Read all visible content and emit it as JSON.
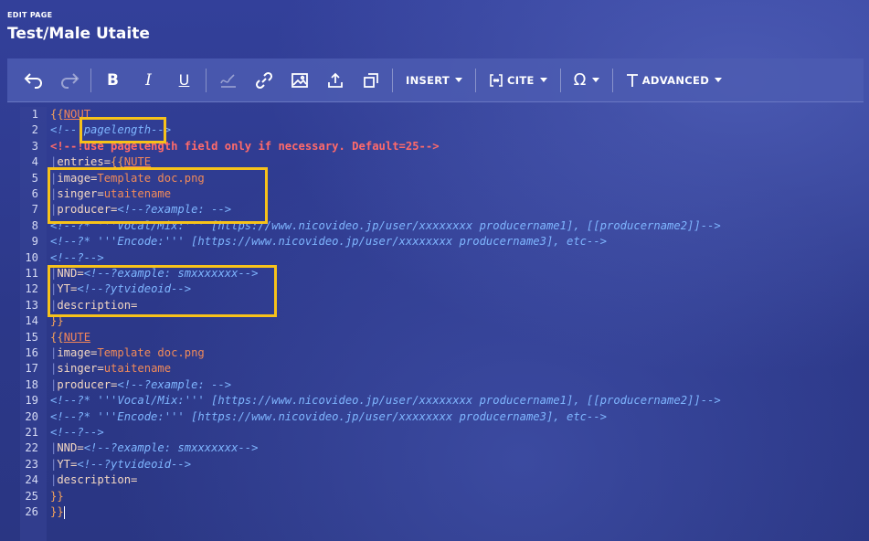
{
  "header": {
    "eyebrow": "EDIT PAGE",
    "title": "Test/Male Utaite"
  },
  "toolbar": {
    "undo_icon": "undo-icon",
    "redo_icon": "redo-icon",
    "bold_label": "B",
    "italic_label": "I",
    "underline_label": "U",
    "insert_label": "INSERT",
    "cite_label": "CITE",
    "special_label": "Ω",
    "advanced_label": "ADVANCED"
  },
  "colors": {
    "highlight_box": "#f7c21a",
    "background": "#2f3b8c"
  },
  "editor": {
    "line_numbers": [
      "1",
      "2",
      "3",
      "4",
      "5",
      "6",
      "7",
      "8",
      "9",
      "10",
      "11",
      "12",
      "13",
      "14",
      "15",
      "16",
      "17",
      "18",
      "19",
      "20",
      "21",
      "22",
      "23",
      "24",
      "25",
      "26"
    ],
    "lines": [
      [
        "{{",
        "NOUT"
      ],
      [
        "<!--",
        "|pagelength",
        "-->"
      ],
      [
        "<!--!use pagelength field only if necessary. Default=25-->"
      ],
      [
        "|",
        "entries=",
        "{{",
        "NUTE"
      ],
      [
        "|",
        "image=",
        "Template doc.png"
      ],
      [
        "|",
        "singer=",
        "utaitename"
      ],
      [
        "|",
        "producer=",
        "<!--?example: -->"
      ],
      [
        "<!--?* '''Vocal/Mix:''' [https://www.nicovideo.jp/user/xxxxxxxx producername1], [[producername2]]-->"
      ],
      [
        "<!--?* '''Encode:''' [https://www.nicovideo.jp/user/xxxxxxxx producername3], etc-->"
      ],
      [
        "<!--?-->"
      ],
      [
        "|",
        "NND=",
        "<!--?example: smxxxxxxx-->"
      ],
      [
        "|",
        "YT=",
        "<!--?ytvideoid-->"
      ],
      [
        "|",
        "description="
      ],
      [
        "}}"
      ],
      [
        "{{",
        "NUTE"
      ],
      [
        "|",
        "image=",
        "Template doc.png"
      ],
      [
        "|",
        "singer=",
        "utaitename"
      ],
      [
        "|",
        "producer=",
        "<!--?example: -->"
      ],
      [
        "<!--?* '''Vocal/Mix:''' [https://www.nicovideo.jp/user/xxxxxxxx producername1], [[producername2]]-->"
      ],
      [
        "<!--?* '''Encode:''' [https://www.nicovideo.jp/user/xxxxxxxx producername3], etc-->"
      ],
      [
        "<!--?-->"
      ],
      [
        "|",
        "NND=",
        "<!--?example: smxxxxxxx-->"
      ],
      [
        "|",
        "YT=",
        "<!--?ytvideoid-->"
      ],
      [
        "|",
        "description="
      ],
      [
        "}}"
      ],
      [
        "}}"
      ]
    ]
  }
}
